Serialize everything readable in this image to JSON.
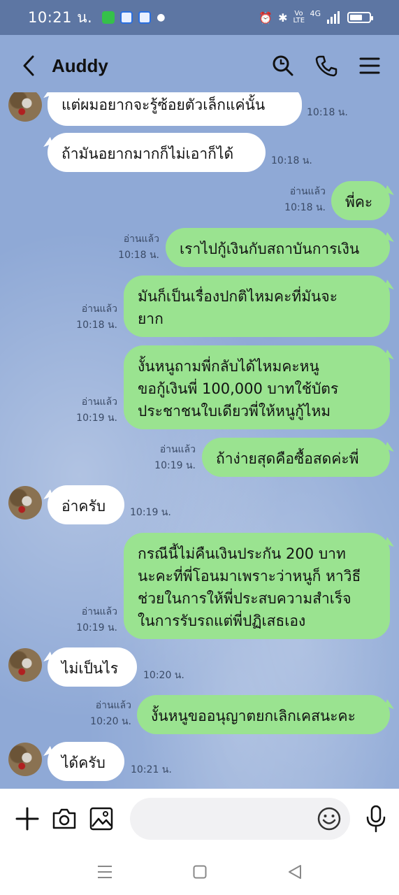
{
  "status_bar": {
    "time": "10:21 น.",
    "network_label": "4G",
    "volte_label": "Vo LTE"
  },
  "header": {
    "title": "Auddy",
    "icons": [
      "back-icon",
      "search-icon",
      "phone-icon",
      "menu-icon"
    ]
  },
  "messages": [
    {
      "side": "in",
      "text": "แต่ผมอยากจะรู้ซ้อยตัวเล็กแค่นั้น",
      "time": "10:18 น.",
      "avatar": true
    },
    {
      "side": "in",
      "text": "ถ้ามันอยากมากก็ไม่เอาก็ได้",
      "time": "10:18 น.",
      "avatar": false
    },
    {
      "side": "out",
      "text": "พี่คะ",
      "time": "10:18 น.",
      "read": "อ่านแล้ว"
    },
    {
      "side": "out",
      "text": "เราไปกู้เงินกับสถาบันการเงิน",
      "time": "10:18 น.",
      "read": "อ่านแล้ว"
    },
    {
      "side": "out",
      "text": "มันก็เป็นเรื่องปกติไหมคะที่มันจะ\nยาก",
      "time": "10:18 น.",
      "read": "อ่านแล้ว"
    },
    {
      "side": "out",
      "text": "งั้นหนูถามพี่กลับได้ไหมคะหนู\nขอกู้เงินพี่ 100,000 บาทใช้บัตร\nประชาชนใบเดียวพี่ให้หนูกู้ไหม",
      "time": "10:19 น.",
      "read": "อ่านแล้ว"
    },
    {
      "side": "out",
      "text": "ถ้าง่ายสุดคือซื้อสดค่ะพี่",
      "time": "10:19 น.",
      "read": "อ่านแล้ว"
    },
    {
      "side": "in",
      "text": "อ่าครับ",
      "time": "10:19 น.",
      "avatar": true
    },
    {
      "side": "out",
      "text": "กรณีนี้ไม่คืนเงินประกัน 200 บาท\nนะคะที่พี่โอนมาเพราะว่าหนูก็ หาวิธี\nช่วยในการให้พี่ประสบความสำเร็จ\nในการรับรถแต่พี่ปฏิเสธเอง",
      "time": "10:19 น.",
      "read": "อ่านแล้ว"
    },
    {
      "side": "in",
      "text": "ไม่เป็นไร",
      "time": "10:20 น.",
      "avatar": true
    },
    {
      "side": "out",
      "text": "งั้นหนูขออนุญาตยกเลิกเคสนะคะ",
      "time": "10:20 น.",
      "read": "อ่านแล้ว"
    },
    {
      "side": "in",
      "text": "ได้ครับ",
      "time": "10:21 น.",
      "avatar": true
    }
  ],
  "composer": {
    "placeholder": "",
    "icons": [
      "plus-icon",
      "camera-icon",
      "image-icon",
      "emoji-icon",
      "microphone-icon"
    ]
  },
  "navbar": {
    "icons": [
      "recents-icon",
      "home-icon",
      "back-nav-icon"
    ]
  }
}
